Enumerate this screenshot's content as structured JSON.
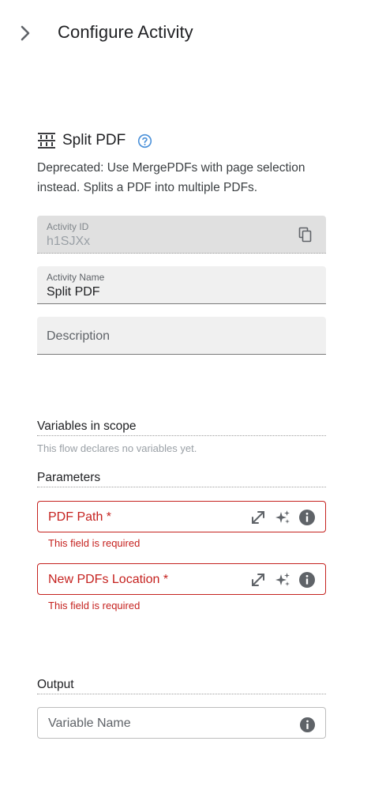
{
  "header": {
    "title": "Configure Activity",
    "collapse_icon": "chevron-right-icon"
  },
  "activity": {
    "icon": "split-pdf-icon",
    "title": "Split PDF",
    "help_icon": "help-circle-icon",
    "description": "Deprecated: Use MergePDFs with page selection instead. Splits a PDF into multiple PDFs."
  },
  "fields": {
    "activity_id": {
      "label": "Activity ID",
      "value": "h1SJXx",
      "copy_icon": "copy-icon"
    },
    "activity_name": {
      "label": "Activity Name",
      "value": "Split PDF"
    },
    "description": {
      "placeholder": "Description"
    }
  },
  "variables": {
    "heading": "Variables in scope",
    "empty_text": "This flow declares no variables yet."
  },
  "parameters": {
    "heading": "Parameters",
    "items": [
      {
        "label": "PDF Path *",
        "error": "This field is required"
      },
      {
        "label": "New PDFs Location *",
        "error": "This field is required"
      }
    ]
  },
  "output": {
    "heading": "Output",
    "placeholder": "Variable Name"
  },
  "colors": {
    "error": "#c5221f",
    "help": "#4a90d9",
    "field_bg": "#f0f0f0"
  }
}
